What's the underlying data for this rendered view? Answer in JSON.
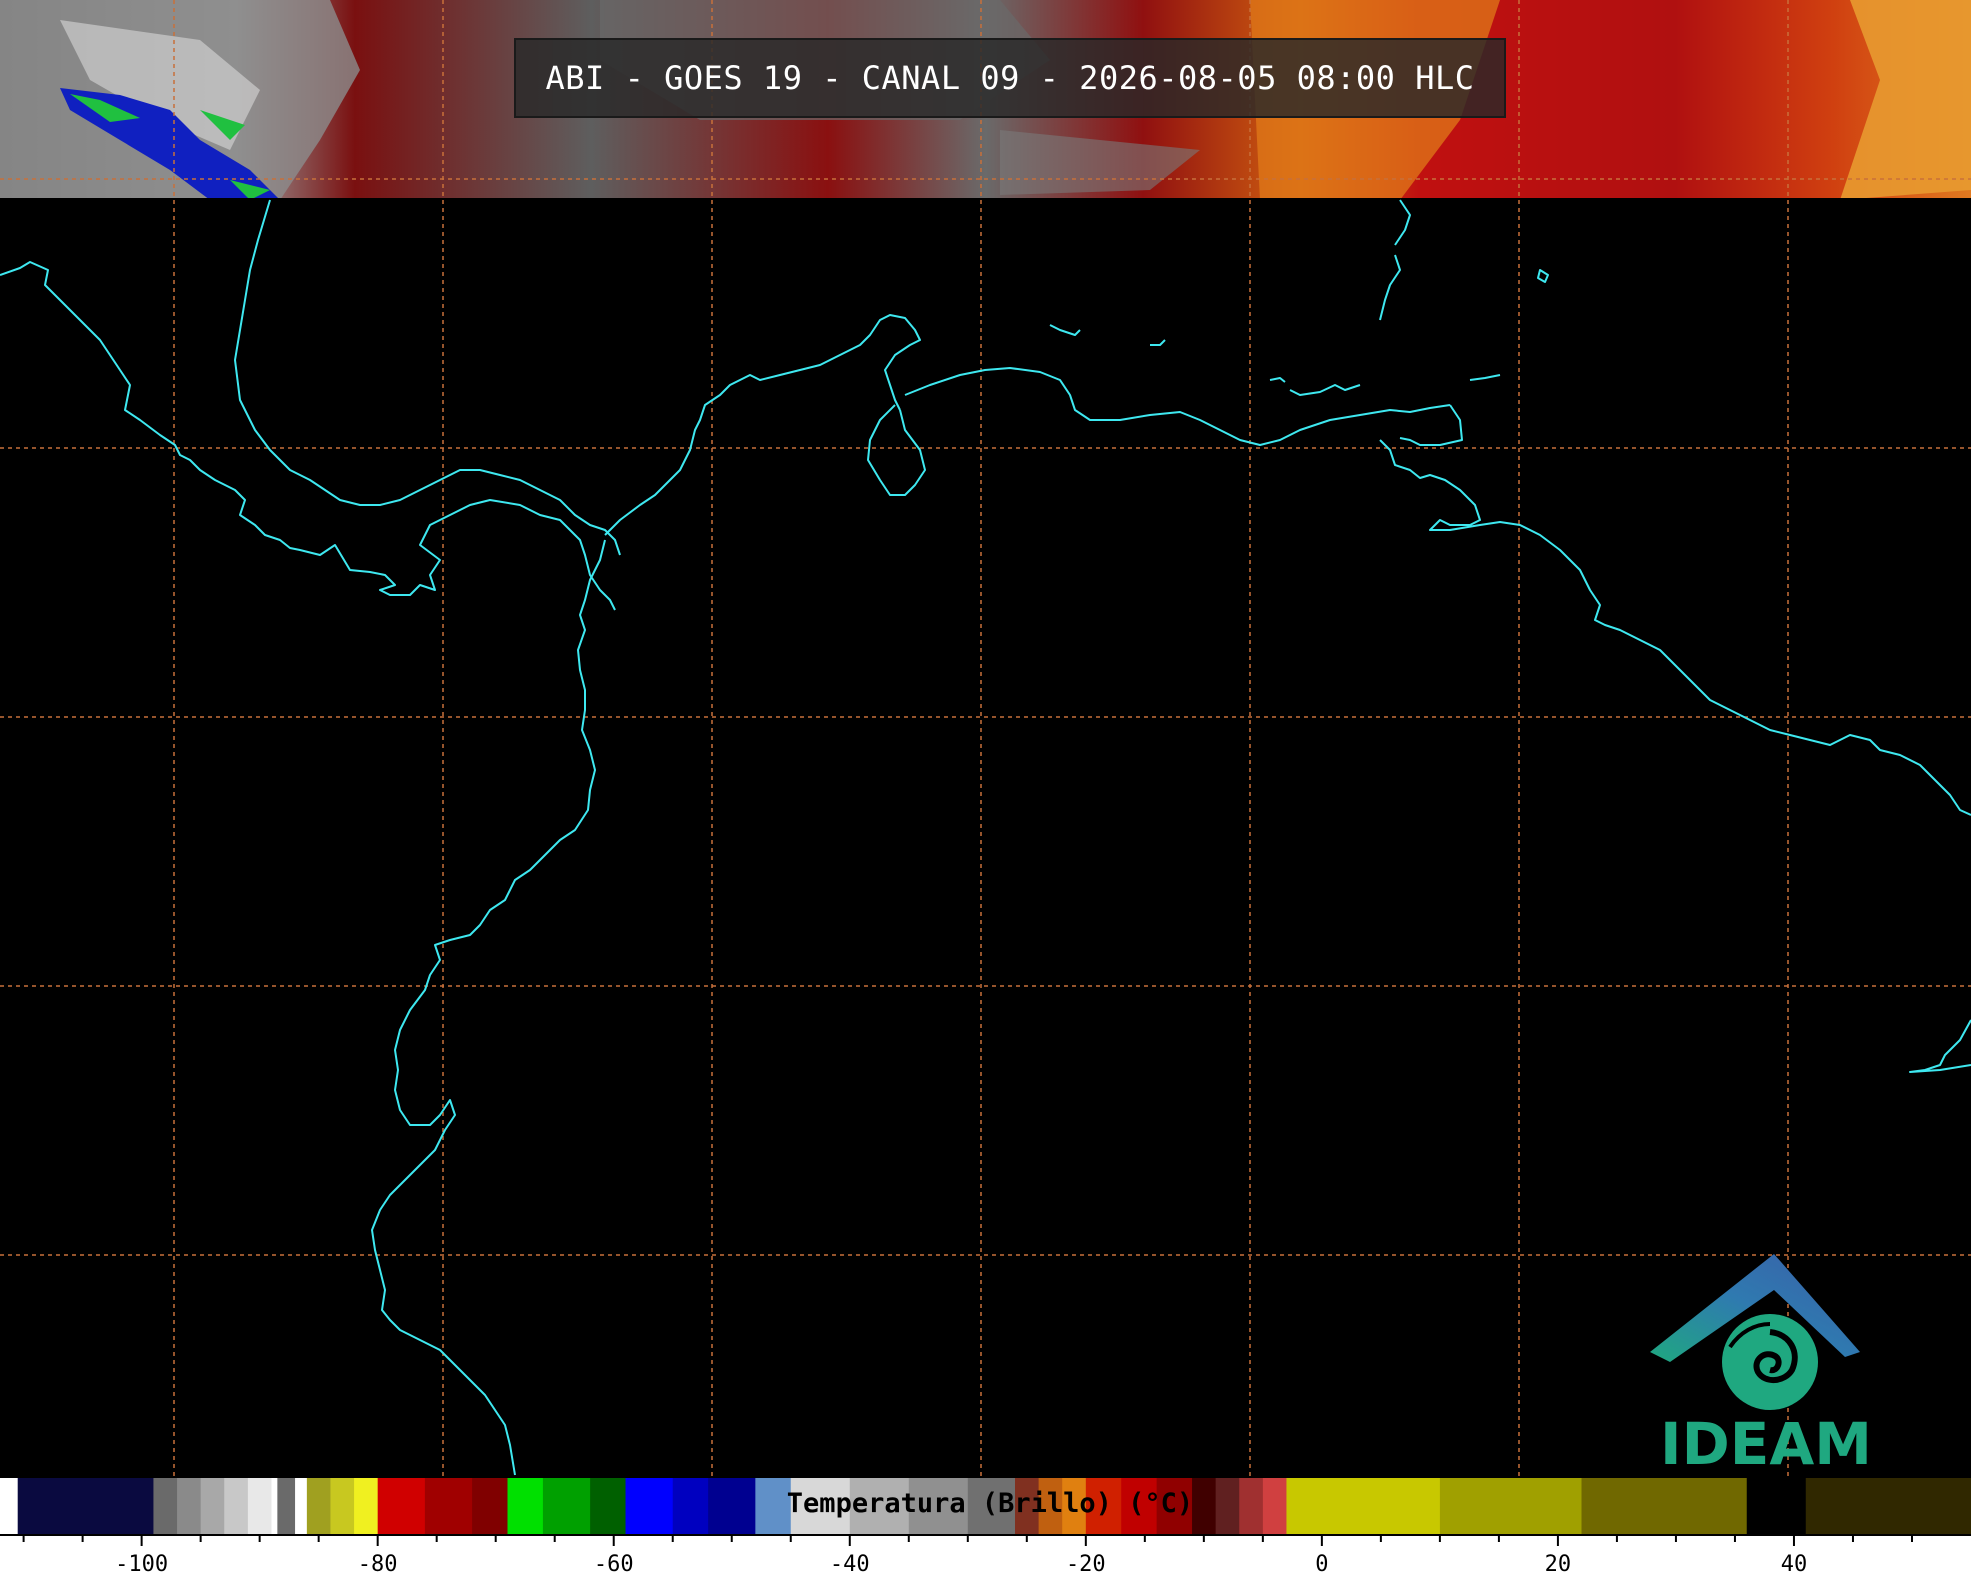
{
  "title": "ABI - GOES 19 - CANAL 09 - 2026-08-05 08:00 HLC",
  "colorbar": {
    "label": "Temperatura (Brillo) (°C)",
    "tick_labels": [
      "-100",
      "-80",
      "-60",
      "-40",
      "-20",
      "0",
      "20",
      "40"
    ],
    "tick_values": [
      -100,
      -80,
      -60,
      -40,
      -20,
      0,
      20,
      40
    ],
    "range": [
      -112,
      55
    ]
  },
  "logo": {
    "text": "IDEAM"
  },
  "colors": {
    "coastline": "#3ee8f0",
    "grid": "#c8703a",
    "background": "#000000"
  }
}
